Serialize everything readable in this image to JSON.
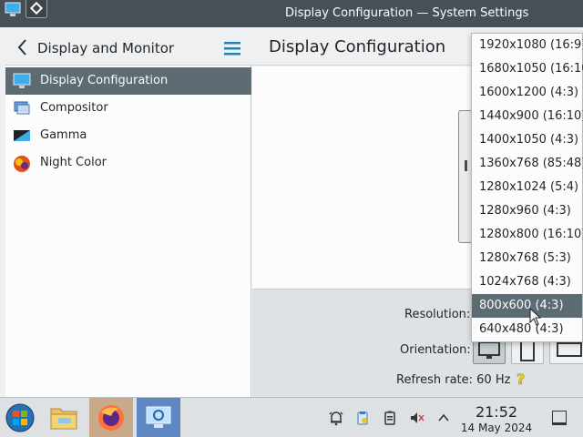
{
  "window": {
    "title": "Display Configuration — System Settings"
  },
  "sidebar": {
    "title": "Display and Monitor",
    "items": [
      {
        "label": "Display Configuration",
        "icon": "monitor-icon",
        "selected": true
      },
      {
        "label": "Compositor",
        "icon": "compositor-icon",
        "selected": false
      },
      {
        "label": "Gamma",
        "icon": "gamma-icon",
        "selected": false
      },
      {
        "label": "Night Color",
        "icon": "night-color-icon",
        "selected": false
      }
    ]
  },
  "main": {
    "title": "Display Configuration",
    "resolution_label": "Resolution:",
    "orientation_label": "Orientation:",
    "refresh_rate": "Refresh rate: 60 Hz"
  },
  "resolution_dropdown": {
    "options": [
      "1920x1080 (16:9)",
      "1680x1050 (16:10)",
      "1600x1200 (4:3)",
      "1440x900 (16:10)",
      "1400x1050 (4:3)",
      "1360x768 (85:48)",
      "1280x1024 (5:4)",
      "1280x960 (4:3)",
      "1280x800 (16:10)",
      "1280x768 (5:3)",
      "1024x768 (4:3)",
      "800x600 (4:3)",
      "640x480 (4:3)"
    ],
    "highlighted": "800x600 (4:3)"
  },
  "taskbar": {
    "apps": [
      "start-menu",
      "file-manager",
      "firefox",
      "system-settings"
    ],
    "tray": [
      "notifications-icon",
      "clipboard-icon",
      "battery-icon",
      "volume-muted-icon",
      "tray-expand-icon"
    ],
    "time": "21:52",
    "date": "14 May 2024"
  },
  "colors": {
    "titlebar": "#475057",
    "selection": "#5d6b73",
    "panel": "#eff0f1",
    "accent": "#3daee9"
  }
}
